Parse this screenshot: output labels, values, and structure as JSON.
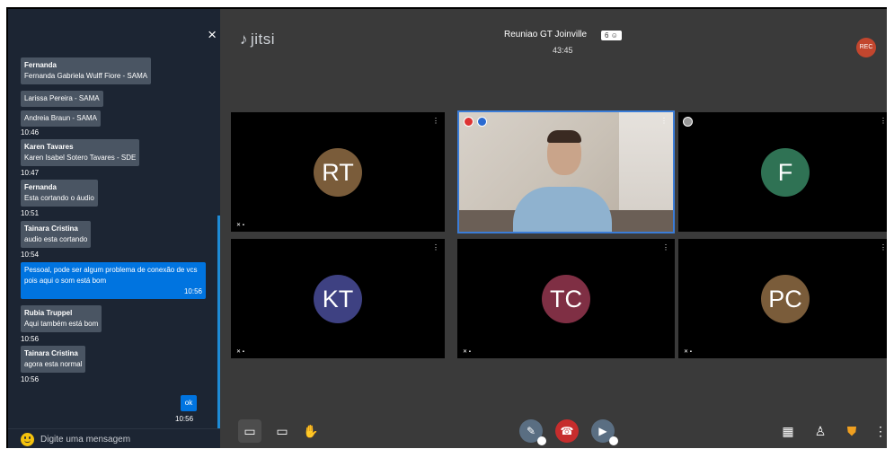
{
  "chat": {
    "close_icon": "×",
    "placeholder": "Digite uma mensagem",
    "messages": [
      {
        "sender": "Fernanda",
        "text": "Fernanda Gabriela Wulff Fiore - SAMA"
      },
      {
        "text": "Larissa Pereira - SAMA"
      },
      {
        "text": "Andreia Braun - SAMA",
        "time": "10:46"
      },
      {
        "sender": "Karen Tavares",
        "text": "Karen Isabel Sotero Tavares - SDE",
        "time": "10:47"
      },
      {
        "sender": "Fernanda",
        "text": "Esta cortando o áudio",
        "time": "10:51"
      },
      {
        "sender": "Tainara Cristina",
        "text": "audio esta cortando",
        "time": "10:54"
      },
      {
        "own": true,
        "text": "Pessoal, pode ser algum problema de conexão de vcs pois aqui o som está bom",
        "time": "10:56"
      },
      {
        "sender": "Rubia Truppel",
        "text": "Aqui também está bom",
        "time": "10:56"
      },
      {
        "sender": "Tainara Cristina",
        "text": "agora esta normal",
        "time": "10:56"
      },
      {
        "own": true,
        "text": "ok",
        "time": "10:56"
      }
    ]
  },
  "header": {
    "logo": "jitsi",
    "meeting_title": "Reuniao GT Joinville",
    "participant_count": "6",
    "timer": "43:45",
    "rec_label": "REC"
  },
  "tiles": [
    {
      "initials": "RT",
      "color": "#7a5c3a"
    },
    {
      "initials": "",
      "video": true
    },
    {
      "initials": "F",
      "color": "#2f7254"
    },
    {
      "initials": "KT",
      "color": "#3e4182"
    },
    {
      "initials": "TC",
      "color": "#7f2f44"
    },
    {
      "initials": "PC",
      "color": "#7a5c3a"
    }
  ],
  "colors": {
    "chat_bg": "#1c2533",
    "stage_bg": "#3a3a3a",
    "accent": "#0074e0",
    "hangup": "#c62d2d"
  },
  "icons": {
    "chat": "chat-icon",
    "screen": "screenshare-icon",
    "hand": "raise-hand-icon",
    "mic": "mic-muted-icon",
    "hangup": "hangup-icon",
    "camera": "camera-muted-icon",
    "tile_view": "tile-view-icon",
    "invite": "invite-icon",
    "security": "shield-icon",
    "more": "more-icon"
  }
}
